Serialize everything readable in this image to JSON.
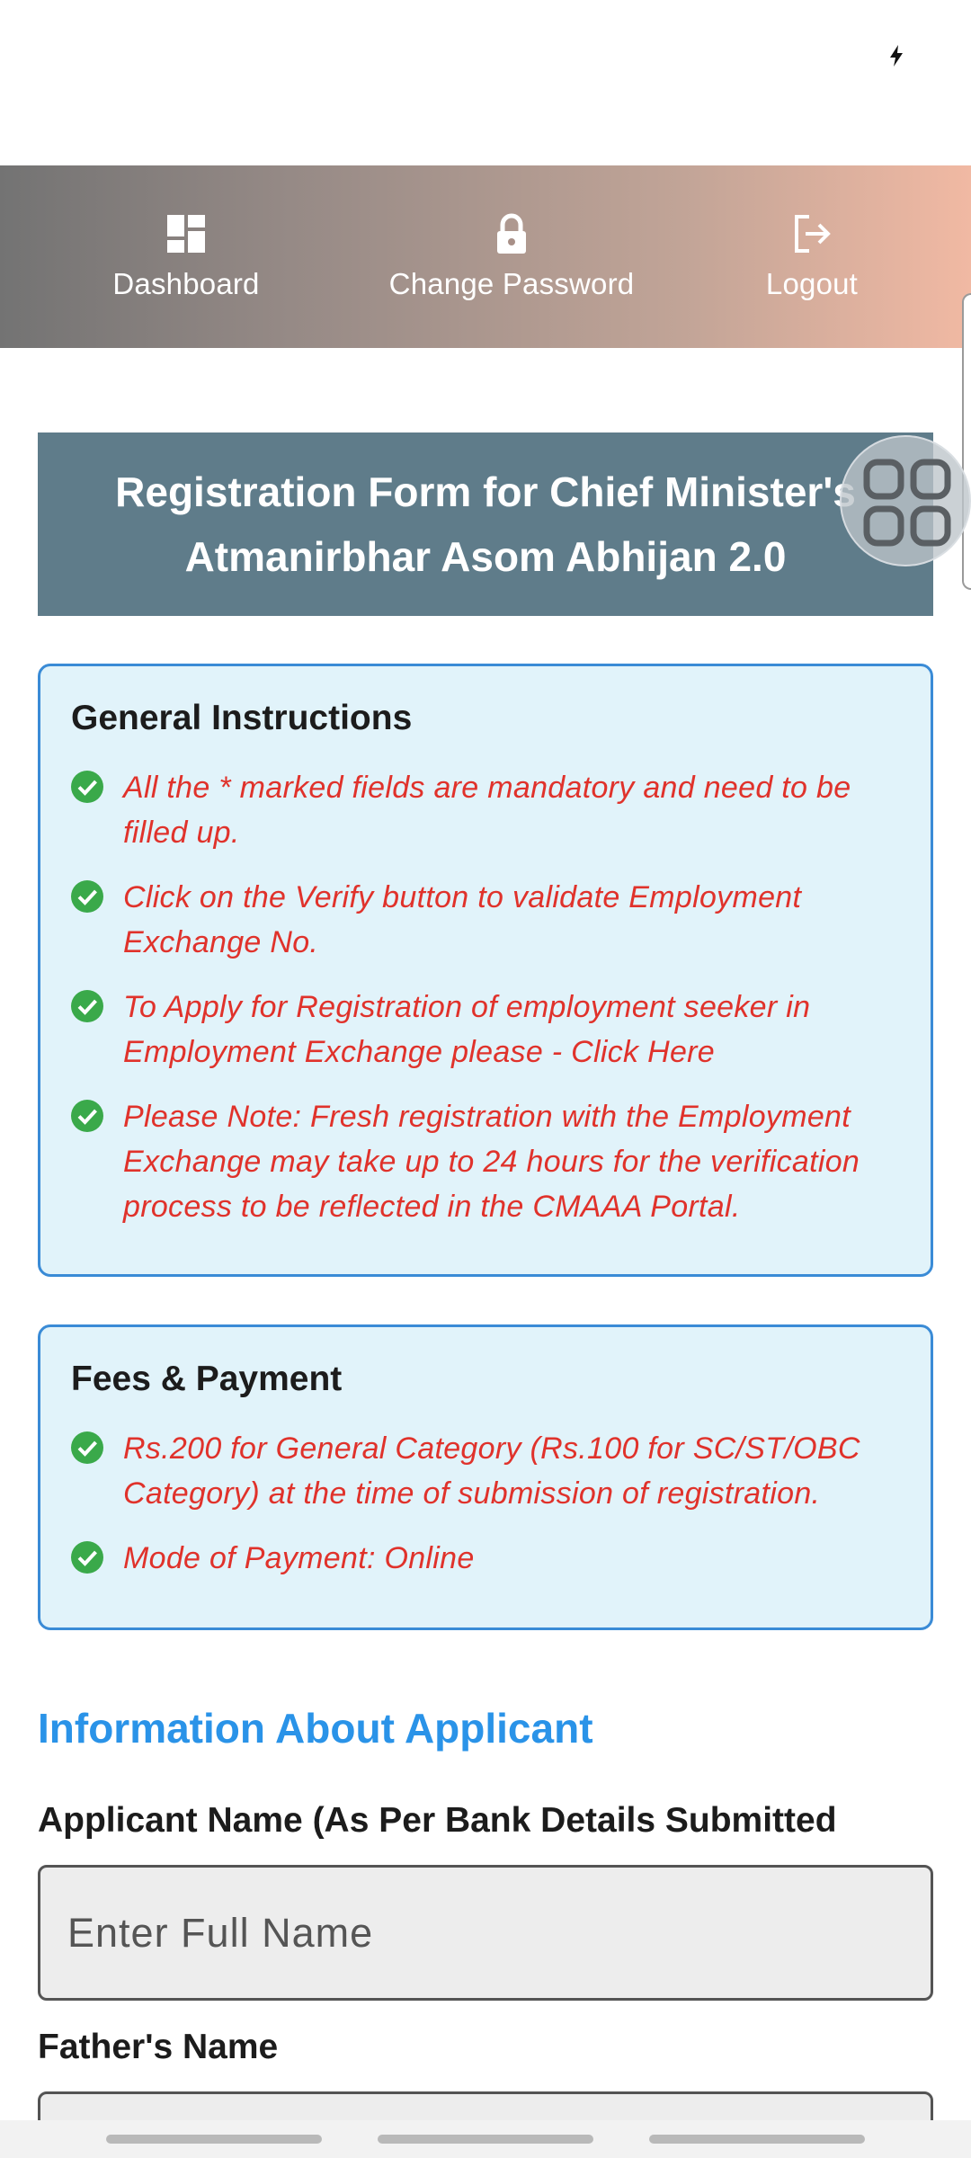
{
  "nav": {
    "items": [
      {
        "label": "Dashboard",
        "icon": "dashboard-icon"
      },
      {
        "label": "Change Password",
        "icon": "lock-icon"
      },
      {
        "label": "Logout",
        "icon": "logout-icon"
      }
    ]
  },
  "banner": {
    "title": "Registration Form for Chief Minister's Atmanirbhar Asom Abhijan 2.0"
  },
  "instructions": {
    "title": "General Instructions",
    "items": [
      "All the * marked fields are mandatory and need to be filled up.",
      "Click on the Verify button to validate Employment Exchange No.",
      "To Apply for Registration of employment seeker in Employment Exchange please - Click Here",
      "Please Note: Fresh registration with the Employment Exchange may take up to 24 hours for the verification process to be reflected in the CMAAA Portal."
    ]
  },
  "fees": {
    "title": "Fees & Payment",
    "items": [
      "Rs.200 for General Category (Rs.100 for SC/ST/OBC Category) at the time of submission of registration.",
      "Mode of Payment: Online"
    ]
  },
  "form": {
    "section_title": "Information About Applicant",
    "applicant_name_label": "Applicant Name (As Per Bank Details Submitted",
    "applicant_name_placeholder": "Enter Full Name",
    "applicant_name_value": "",
    "father_name_label": "Father's Name",
    "father_name_value": ""
  },
  "colors": {
    "banner_bg": "#5f7c8a",
    "card_bg": "#e1f3fa",
    "card_border": "#3a8bd6",
    "instruction_text": "#e0322b",
    "check": "#3aa94a",
    "section_title": "#2a93e8"
  }
}
